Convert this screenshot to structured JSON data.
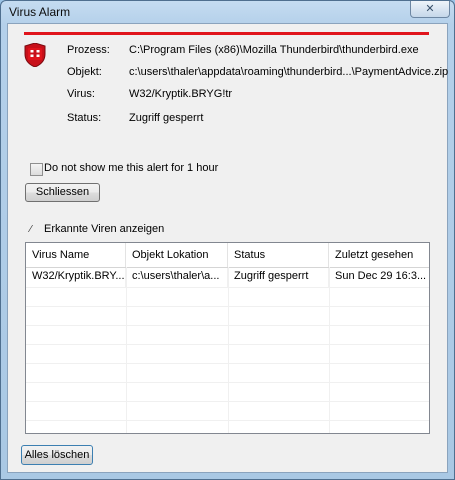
{
  "window": {
    "title": "Virus Alarm",
    "close_glyph": "✕"
  },
  "details": [
    {
      "label": "Prozess:",
      "value": "C:\\Program Files (x86)\\Mozilla Thunderbird\\thunderbird.exe"
    },
    {
      "label": "Objekt:",
      "value": "c:\\users\\thaler\\appdata\\roaming\\thunderbird...\\PaymentAdvice.zip"
    },
    {
      "label": "Virus:",
      "value": "W32/Kryptik.BRYG!tr"
    },
    {
      "label": "Status:",
      "value": "Zugriff gesperrt"
    }
  ],
  "mute_checkbox": {
    "label": "Do not show me this alert for 1 hour",
    "checked": false
  },
  "buttons": {
    "close_label": "Schliessen",
    "clear_label": "Alles löschen"
  },
  "virus_list_toggle": {
    "label": "Erkannte Viren anzeigen",
    "icon": "toggle-arrow-icon",
    "glyph": "⁄"
  },
  "table": {
    "columns": [
      "Virus Name",
      "Objekt Lokation",
      "Status",
      "Zuletzt gesehen"
    ],
    "rows": [
      [
        "W32/Kryptik.BRY...",
        "c:\\users\\thaler\\a...",
        "Zugriff gesperrt",
        "Sun Dec 29 16:3..."
      ]
    ]
  },
  "colors": {
    "accent_red": "#e0141c",
    "titlebar": "#b4d0ea"
  }
}
